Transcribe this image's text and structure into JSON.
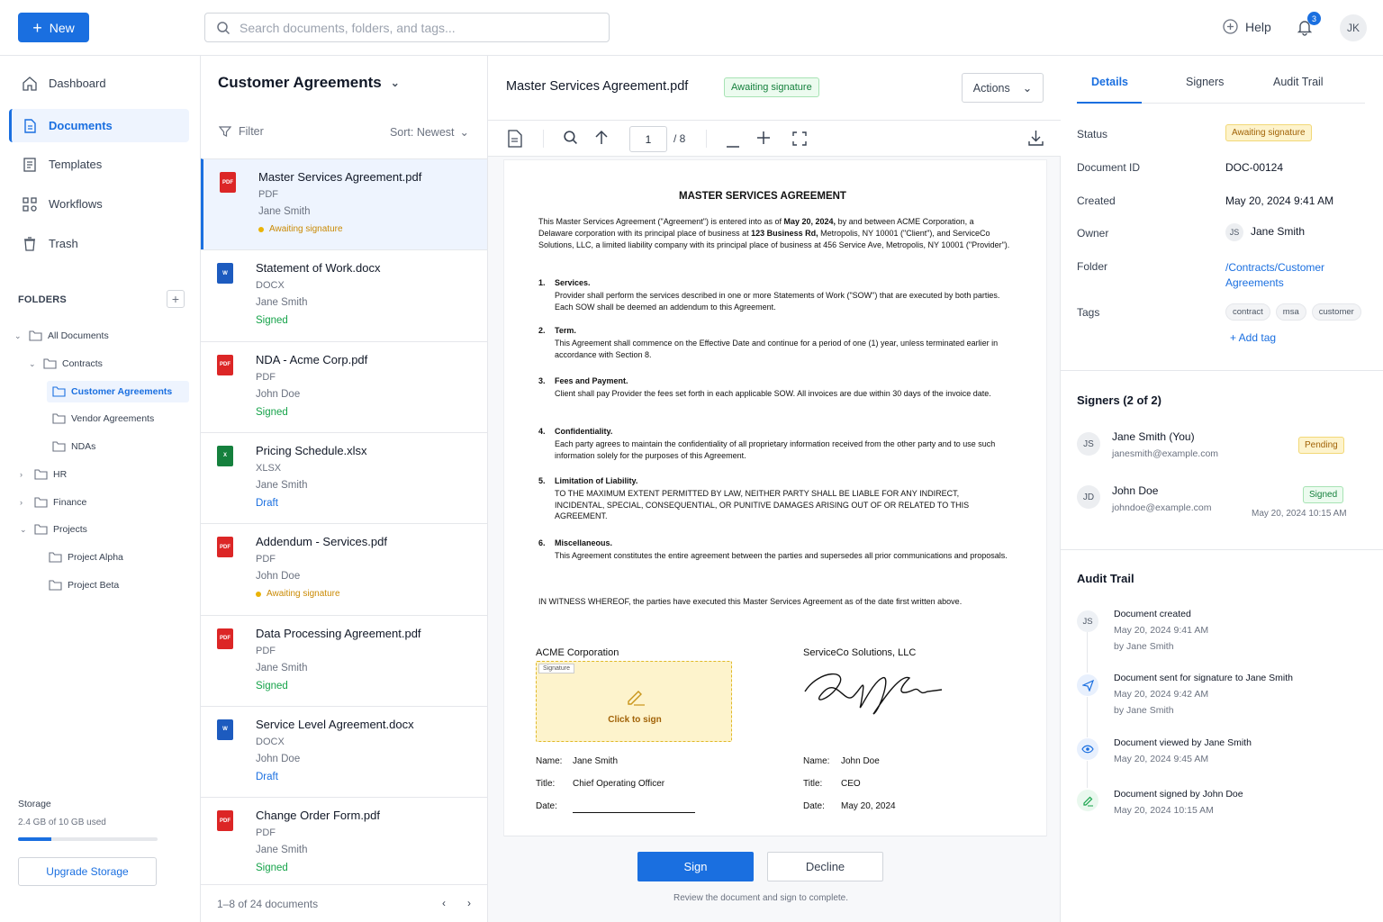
{
  "topbar": {
    "new_label": "New",
    "search_placeholder": "Search documents, folders, and tags...",
    "help_label": "Help",
    "notification_count": "3",
    "user_initials": "JK"
  },
  "sidebar": {
    "nav": [
      {
        "label": "Dashboard",
        "icon": "home-icon"
      },
      {
        "label": "Documents",
        "icon": "document-icon",
        "active": true
      },
      {
        "label": "Templates",
        "icon": "template-icon"
      },
      {
        "label": "Workflows",
        "icon": "workflow-icon"
      },
      {
        "label": "Trash",
        "icon": "trash-icon"
      }
    ],
    "folders_heading": "FOLDERS",
    "tree": [
      {
        "label": "All Documents"
      },
      {
        "label": "Contracts"
      },
      {
        "label": "Customer Agreements"
      },
      {
        "label": "Vendor Agreements"
      },
      {
        "label": "NDAs"
      },
      {
        "label": "HR"
      },
      {
        "label": "Finance"
      },
      {
        "label": "Projects"
      },
      {
        "label": "Project Alpha"
      },
      {
        "label": "Project Beta"
      }
    ],
    "storage_label": "Storage",
    "storage_value": "2.4 GB of 10 GB used",
    "storage_fraction": 0.24,
    "upgrade_label": "Upgrade Storage"
  },
  "list": {
    "title": "Customer Agreements",
    "filter_label": "Filter",
    "sort_label": "Sort:  Newest",
    "documents": [
      {
        "name": "Master Services Agreement.pdf",
        "type": "PDF",
        "owner": "Jane Smith",
        "status": "Awaiting signature",
        "kind": "pdf",
        "icon_text": "PDF"
      },
      {
        "name": "Statement of Work.docx",
        "type": "DOCX",
        "owner": "Jane Smith",
        "status": "Signed",
        "kind": "docx",
        "icon_text": "W"
      },
      {
        "name": "NDA - Acme Corp.pdf",
        "type": "PDF",
        "owner": "John Doe",
        "status": "Signed",
        "kind": "pdf",
        "icon_text": "PDF"
      },
      {
        "name": "Pricing Schedule.xlsx",
        "type": "XLSX",
        "owner": "Jane Smith",
        "status": "Draft",
        "kind": "xlsx",
        "icon_text": "X"
      },
      {
        "name": "Addendum - Services.pdf",
        "type": "PDF",
        "owner": "John Doe",
        "status": "Awaiting signature",
        "kind": "pdf",
        "icon_text": "PDF"
      },
      {
        "name": "Data Processing Agreement.pdf",
        "type": "PDF",
        "owner": "Jane Smith",
        "status": "Signed",
        "kind": "pdf",
        "icon_text": "PDF"
      },
      {
        "name": "Service Level Agreement.docx",
        "type": "DOCX",
        "owner": "John Doe",
        "status": "Draft",
        "kind": "docx",
        "icon_text": "W"
      },
      {
        "name": "Change Order Form.pdf",
        "type": "PDF",
        "owner": "Jane Smith",
        "status": "Signed",
        "kind": "pdf",
        "icon_text": "PDF"
      }
    ],
    "footer": "1–8 of 24 documents"
  },
  "viewer": {
    "title": "Master Services Agreement.pdf",
    "status": "Awaiting signature",
    "actions_label": "Actions",
    "page_current": "1",
    "page_total": "/ 8",
    "doc_title": "MASTER SERVICES AGREEMENT",
    "intro_1": "This Master Services Agreement (\"Agreement\") is entered into as of ",
    "intro_date": "May 20, 2024,",
    "intro_2": " by and between ACME Corporation, a Delaware corporation with its principal place of business at ",
    "intro_addr": "123 Business Rd,",
    "intro_3": " Metropolis, NY 10001 (\"Client\"), and ServiceCo Solutions, LLC, a limited liability company with its principal place of business at 456 Service Ave, Metropolis, NY 10001 (\"Provider\").",
    "sections": [
      {
        "num": "1.",
        "heading": "Services.",
        "body": "Provider shall perform the services described in one or more Statements of Work (\"SOW\") that are executed by both parties. Each SOW shall be deemed an addendum to this Agreement."
      },
      {
        "num": "2.",
        "heading": "Term.",
        "body": "This Agreement shall commence on the Effective Date and continue for a period of one (1) year, unless terminated earlier in accordance with Section 8."
      },
      {
        "num": "3.",
        "heading": "Fees and Payment.",
        "body": "Client shall pay Provider the fees set forth in each applicable SOW. All invoices are due within 30 days of the invoice date."
      },
      {
        "num": "4.",
        "heading": "Confidentiality.",
        "body": "Each party agrees to maintain the confidentiality of all proprietary information received from the other party and to use such information solely for the purposes of this Agreement."
      },
      {
        "num": "5.",
        "heading": "Limitation of Liability.",
        "body": "TO THE MAXIMUM EXTENT PERMITTED BY LAW, NEITHER PARTY SHALL BE LIABLE FOR ANY INDIRECT, INCIDENTAL, SPECIAL, CONSEQUENTIAL, OR PUNITIVE DAMAGES ARISING OUT OF OR RELATED TO THIS AGREEMENT."
      },
      {
        "num": "6.",
        "heading": "Miscellaneous.",
        "body": "This Agreement constitutes the entire agreement between the parties and supersedes all prior communications and proposals."
      }
    ],
    "witness": "IN WITNESS WHEREOF, the parties have executed this Master Services Agreement as of the date first written above.",
    "party_a": "ACME Corporation",
    "party_b": "ServiceCo Solutions, LLC",
    "signature_tag": "Signature",
    "click_to_sign": "Click to sign",
    "name_label": "Name:",
    "title_label": "Title:",
    "date_label": "Date:",
    "party_a_name": "Jane Smith",
    "party_a_title": "Chief Operating Officer",
    "party_b_name": "John Doe",
    "party_b_title": "CEO",
    "party_b_date": "May 20, 2024",
    "sign_label": "Sign",
    "decline_label": "Decline",
    "hint": "Review the document and sign to complete."
  },
  "details": {
    "tabs": [
      "Details",
      "Signers",
      "Audit Trail"
    ],
    "status_label": "Status",
    "status_value": "Awaiting signature",
    "docid_label": "Document ID",
    "docid_value": "DOC-00124",
    "created_label": "Created",
    "created_value": "May 20, 2024  9:41 AM",
    "owner_label": "Owner",
    "owner_initials": "JS",
    "owner_value": "Jane Smith",
    "folder_label": "Folder",
    "folder_line1": "/Contracts/Customer",
    "folder_line2": "Agreements",
    "tags_label": "Tags",
    "tags": [
      "contract",
      "msa",
      "customer"
    ],
    "add_tag": "+ Add tag",
    "signers_heading": "Signers (2 of 2)",
    "signers": [
      {
        "initials": "JS",
        "name": "Jane Smith (You)",
        "email": "janesmith@example.com",
        "status": "Pending",
        "date": ""
      },
      {
        "initials": "JD",
        "name": "John Doe",
        "email": "johndoe@example.com",
        "status": "Signed",
        "date": "May 20, 2024 10:15 AM"
      }
    ],
    "audit_heading": "Audit Trail",
    "audit": [
      {
        "icon": "JS",
        "title": "Document created",
        "time": "May 20, 2024 9:41 AM",
        "by": "by Jane Smith"
      },
      {
        "icon": "send-icon",
        "title": "Document sent for signature to Jane Smith",
        "time": "May 20, 2024 9:42 AM",
        "by": "by Jane Smith"
      },
      {
        "icon": "eye-icon",
        "title": "Document viewed by Jane Smith",
        "time": "May 20, 2024 9:45 AM",
        "by": ""
      },
      {
        "icon": "pen-icon",
        "title": "Document signed by John Doe",
        "time": "May 20, 2024 10:15 AM",
        "by": ""
      }
    ]
  },
  "colors": {
    "accent": "#1a6fe0",
    "pdf": "#dc2626",
    "docx": "#1d5bbf",
    "xlsx": "#15803d",
    "signed": "#16a34a",
    "awaiting": "#ca8a04"
  }
}
